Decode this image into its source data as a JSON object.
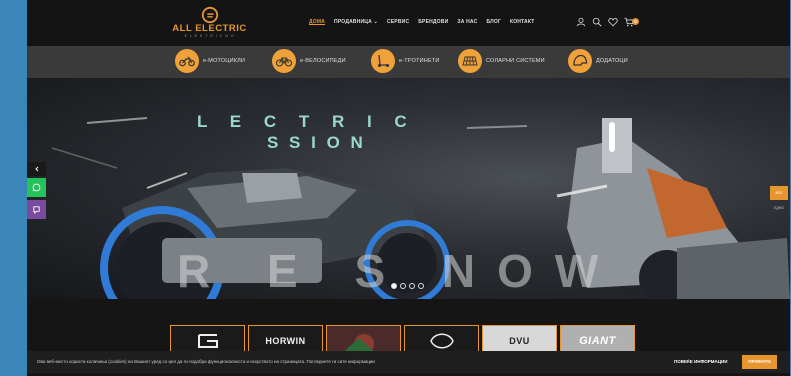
{
  "brand": {
    "logo_text": "ALL ELECTRIC",
    "logo_sub": "E L E K T R I C N O",
    "accent": "#e7962f"
  },
  "nav": [
    {
      "label": "ДОМА",
      "active": true
    },
    {
      "label": "ПРОДАВНИЦА ⌄",
      "active": false
    },
    {
      "label": "СЕРВИС",
      "active": false
    },
    {
      "label": "БРЕНДОВИ",
      "active": false
    },
    {
      "label": "ЗА НАС",
      "active": false
    },
    {
      "label": "БЛОГ",
      "active": false
    },
    {
      "label": "КОНТАКТ",
      "active": false
    }
  ],
  "header_icons": [
    "user-icon",
    "search-icon",
    "heart-icon",
    "cart-icon"
  ],
  "cart_count": "0",
  "categories": [
    {
      "label": "е-МОТОЦИКЛИ",
      "icon": "motorcycle-icon"
    },
    {
      "label": "е-ВЕЛОСИПЕДИ",
      "icon": "bicycle-icon"
    },
    {
      "label": "е-ТРОТИНЕТИ",
      "icon": "scooter-icon"
    },
    {
      "label": "СОЛАРНИ СИСТЕМИ",
      "icon": "solar-panel-icon"
    },
    {
      "label": "ДОДАТОЦИ",
      "icon": "helmet-icon"
    }
  ],
  "hero": {
    "tagline_line1": "L E C T R I C",
    "tagline_line2": "S S I O N",
    "headline": "R E S NOW",
    "slides": 4,
    "active_slide": 1
  },
  "side_buttons": [
    "arrow-left-icon",
    "whatsapp-icon",
    "viber-icon"
  ],
  "right_widget": {
    "button": "ВСЕ",
    "text": "ЕДНО"
  },
  "brands": [
    "",
    "HORWIN",
    "",
    "",
    "DVU",
    "GIANT"
  ],
  "cookie": {
    "text": "Ова веб-место користи колачиња (cookies) на Вашиот уред со цел да ги подобри функционалноста и искуството на страницата. Погледнете ги сите информации",
    "more_label": "ПОВЕЌЕ ИНФОРМАЦИИ",
    "accept_label": "ПРИФАТИ"
  }
}
